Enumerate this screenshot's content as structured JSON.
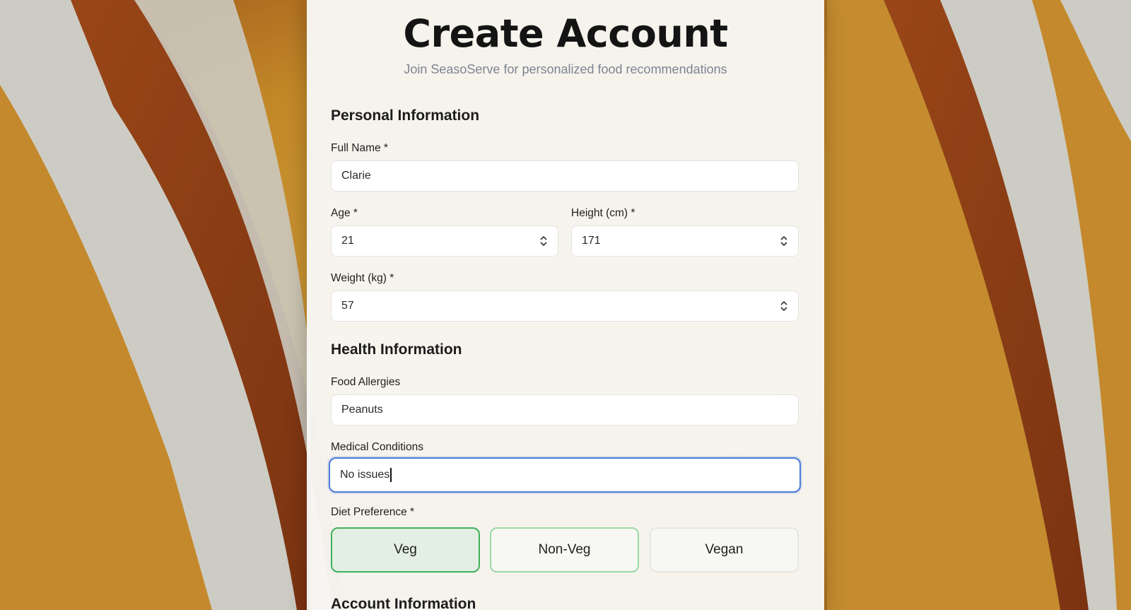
{
  "header": {
    "title": "Create Account",
    "subtitle": "Join SeasoServe for personalized food recommendations"
  },
  "personal": {
    "section_title": "Personal Information",
    "full_name": {
      "label": "Full Name *",
      "value": "Clarie"
    },
    "age": {
      "label": "Age *",
      "value": "21"
    },
    "height": {
      "label": "Height (cm) *",
      "value": "171"
    },
    "weight": {
      "label": "Weight (kg) *",
      "value": "57"
    }
  },
  "health": {
    "section_title": "Health Information",
    "allergies": {
      "label": "Food Allergies",
      "value": "Peanuts"
    },
    "medical": {
      "label": "Medical Conditions",
      "value": "No issues"
    },
    "diet": {
      "label": "Diet Preference *",
      "options": [
        "Veg",
        "Non-Veg",
        "Vegan"
      ],
      "selected": "Veg"
    }
  },
  "account": {
    "section_title": "Account Information"
  },
  "colors": {
    "focus": "#4c7bd9",
    "selected_border": "#3fb15a",
    "selected_fill": "#e2efe2",
    "subtitle": "#7d8591"
  }
}
